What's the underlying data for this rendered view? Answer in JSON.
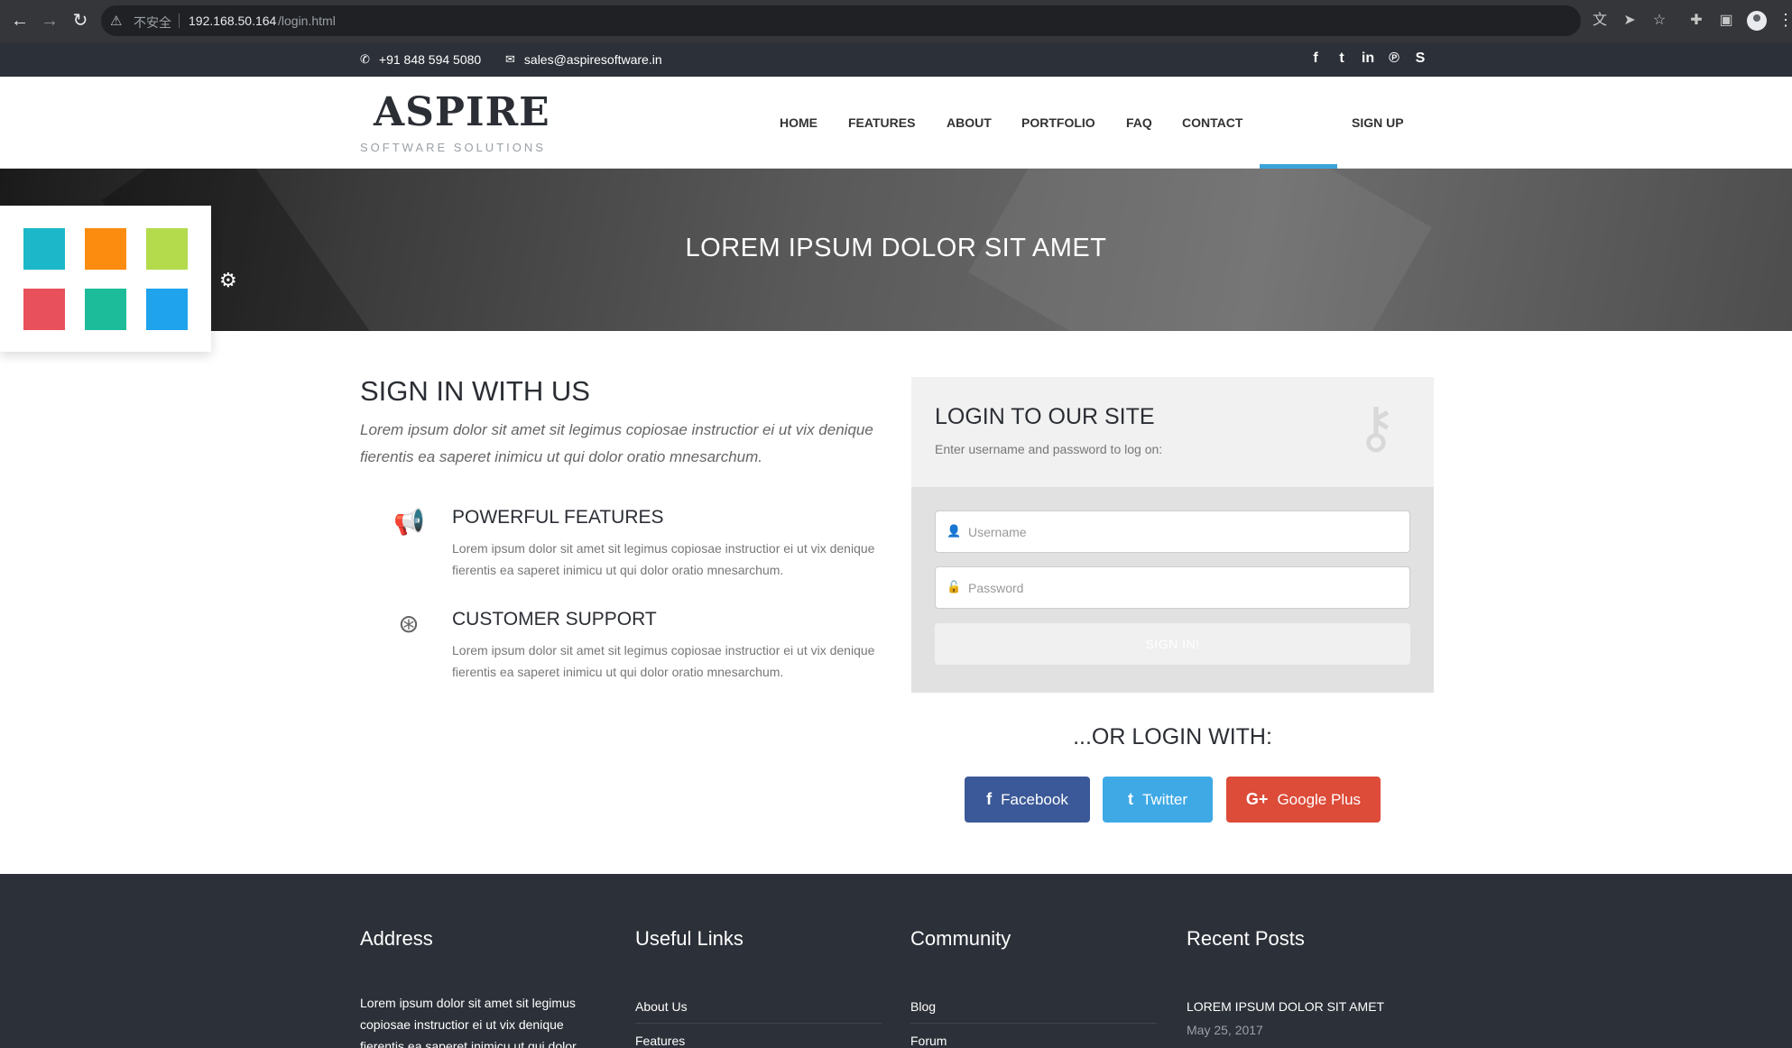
{
  "browser": {
    "security_label": "不安全",
    "url_host": "192.168.50.164",
    "url_path": "/login.html"
  },
  "topbar": {
    "phone": "+91 848 594 5080",
    "email": "sales@aspiresoftware.in",
    "social_icons": [
      "facebook-icon",
      "twitter-icon",
      "linkedin-icon",
      "pinterest-icon",
      "skype-icon"
    ]
  },
  "header": {
    "logo_title": "ASPIRE",
    "logo_subtitle": "SOFTWARE SOLUTIONS",
    "menu": [
      "HOME",
      "FEATURES",
      "ABOUT",
      "PORTFOLIO",
      "FAQ",
      "CONTACT",
      "SIGN UP"
    ]
  },
  "banner": {
    "title": "LOREM IPSUM DOLOR SIT AMET"
  },
  "color_switcher": {
    "colors": [
      "#1cb8c9",
      "#fb8c0f",
      "#b3db4c",
      "#e8505b",
      "#1cbc9b",
      "#1fa3ec"
    ]
  },
  "main": {
    "sign_title": "SIGN IN WITH US",
    "sign_lead": "Lorem ipsum dolor sit amet sit legimus copiosae instructior ei ut vix denique fierentis ea saperet inimicu ut qui dolor oratio mnesarchum.",
    "features": [
      {
        "icon": "megaphone-icon",
        "title": "POWERFUL FEATURES",
        "text": "Lorem ipsum dolor sit amet sit legimus copiosae instructior ei ut vix denique fierentis ea saperet inimicu ut qui dolor oratio mnesarchum."
      },
      {
        "icon": "lifebuoy-icon",
        "title": "CUSTOMER SUPPORT",
        "text": "Lorem ipsum dolor sit amet sit legimus copiosae instructior ei ut vix denique fierentis ea saperet inimicu ut qui dolor oratio mnesarchum."
      }
    ]
  },
  "login": {
    "title": "LOGIN TO OUR SITE",
    "subtitle": "Enter username and password to log on:",
    "username_placeholder": "Username",
    "password_placeholder": "Password",
    "signin_label": "SIGN IN!",
    "or_login_label": "...OR LOGIN WITH:",
    "social": [
      {
        "label": "Facebook",
        "icon": "facebook-icon",
        "color": "#3b5998"
      },
      {
        "label": "Twitter",
        "icon": "twitter-icon",
        "color": "#3fa9e6"
      },
      {
        "label": "Google Plus",
        "icon": "google-plus-icon",
        "color": "#dd4b39"
      }
    ]
  },
  "footer": {
    "address_title": "Address",
    "address_text": "Lorem ipsum dolor sit amet sit legimus copiosae instructior ei ut vix denique fierentis ea saperet inimicu ut qui dolor",
    "links_title": "Useful Links",
    "links": [
      "About Us",
      "Features"
    ],
    "community_title": "Community",
    "community": [
      "Blog",
      "Forum"
    ],
    "posts_title": "Recent Posts",
    "post_title": "LOREM IPSUM DOLOR SIT AMET",
    "post_date": "May 25, 2017"
  }
}
